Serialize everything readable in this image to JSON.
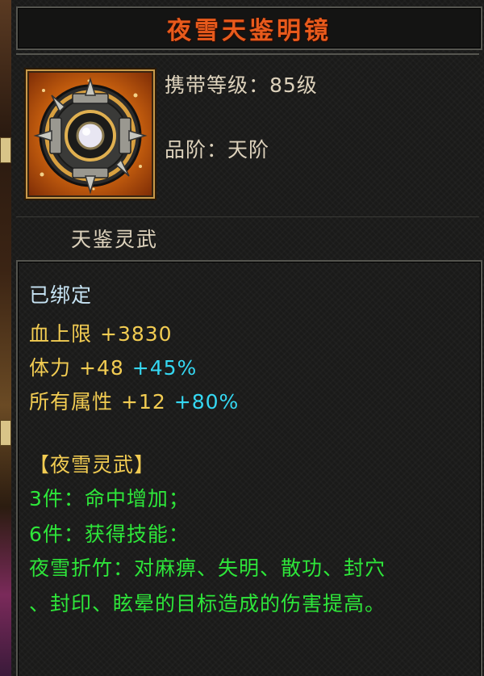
{
  "item": {
    "name": "夜雪天鉴明镜",
    "level_label": "携带等级：85级",
    "grade_label": "品阶：天阶",
    "category": "天鉴灵武"
  },
  "status": {
    "bound": "已绑定"
  },
  "stats": [
    {
      "name": "血上限",
      "value": "+3830",
      "percent": ""
    },
    {
      "name": "体力",
      "value": "+48",
      "percent": "+45%"
    },
    {
      "name": "所有属性",
      "value": "+12",
      "percent": "+80%"
    }
  ],
  "set": {
    "name": "【夜雪灵武】",
    "bonus_3": "3件：命中增加；",
    "bonus_6": "6件：获得技能：",
    "skill_line_1": "夜雪折竹：对麻痹、失明、散功、封穴",
    "skill_line_2": "、封印、眩晕的目标造成的伤害提高。"
  },
  "colors": {
    "title": "#e85a1c",
    "bound": "#c7e4f4",
    "stat": "#f2cc52",
    "percent": "#35d8f2",
    "set_text": "#2ee63a"
  },
  "icons": {
    "item": "mirror-disc-icon"
  }
}
